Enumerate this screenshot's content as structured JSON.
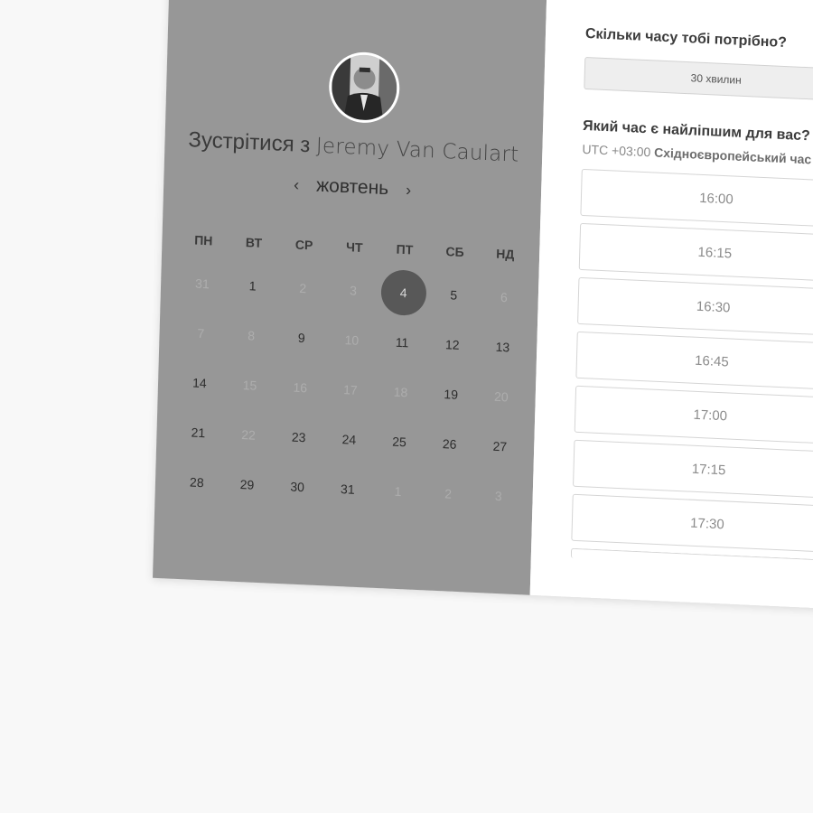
{
  "host": {
    "title_prefix": "Зустрітися з",
    "name": "Jeremy Van Caulart",
    "avatar_icon": "person-photo"
  },
  "calendar": {
    "month": "жовтень",
    "prev_icon": "chevron-left-icon",
    "next_icon": "chevron-right-icon",
    "weekdays": [
      "ПН",
      "ВТ",
      "СР",
      "ЧТ",
      "ПТ",
      "СБ",
      "НД"
    ],
    "weeks": [
      [
        "31",
        "1",
        "2",
        "3",
        "4",
        "5",
        "6"
      ],
      [
        "7",
        "8",
        "9",
        "10",
        "11",
        "12",
        "13"
      ],
      [
        "14",
        "15",
        "16",
        "17",
        "18",
        "19",
        "20"
      ],
      [
        "21",
        "22",
        "23",
        "24",
        "25",
        "26",
        "27"
      ],
      [
        "28",
        "29",
        "30",
        "31",
        "1",
        "2",
        "3"
      ]
    ],
    "selected_day": "4"
  },
  "booking": {
    "duration_question": "Скільки часу тобі потрібно?",
    "duration_value": "30 хвилин",
    "time_question": "Який час є найліпшим для вас?",
    "timezone_offset": "UTC +03:00",
    "timezone_name": "Східноєвропейський час",
    "slots": [
      "16:00",
      "16:15",
      "16:30",
      "16:45",
      "17:00",
      "17:15",
      "17:30"
    ]
  },
  "colors": {
    "left_panel": "#979797",
    "selected_day_bg": "#585858",
    "page_bg": "#f8f8f8"
  }
}
